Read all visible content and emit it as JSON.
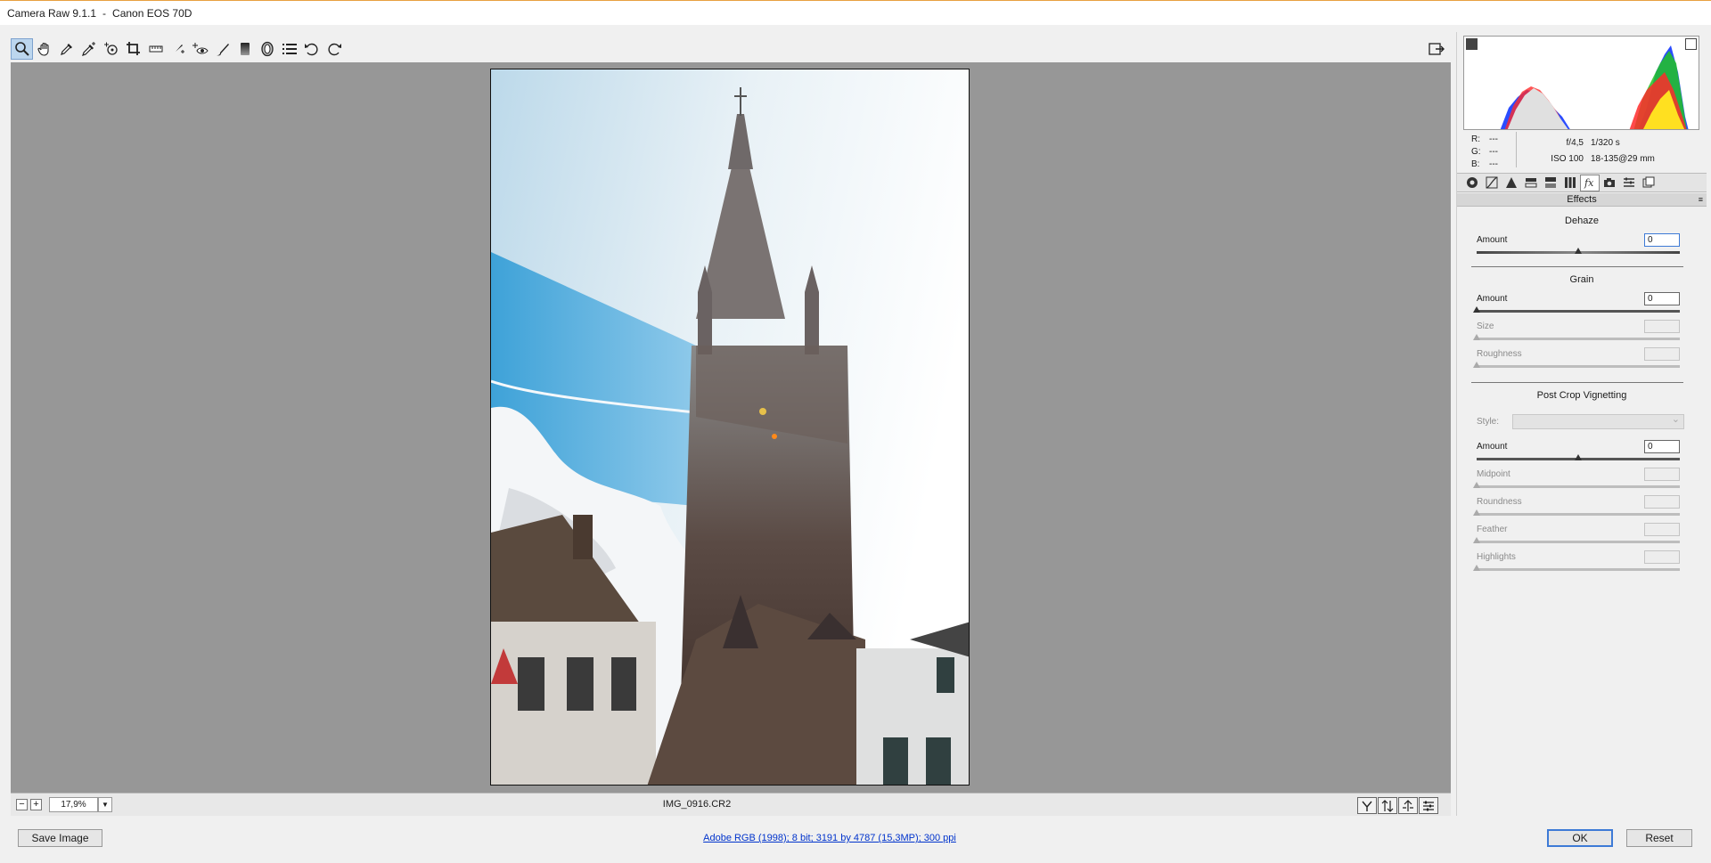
{
  "window": {
    "app": "Camera Raw 9.1.1",
    "separator": "-",
    "camera": "Canon EOS 70D"
  },
  "toolbar": {
    "tools": [
      {
        "name": "zoom-tool",
        "icon": "magnifier-icon",
        "active": true
      },
      {
        "name": "hand-tool",
        "icon": "hand-icon"
      },
      {
        "name": "white-balance-tool",
        "icon": "eyedropper-icon"
      },
      {
        "name": "color-sampler-tool",
        "icon": "color-sampler-icon"
      },
      {
        "name": "targeted-adjustment-tool",
        "icon": "target-icon"
      },
      {
        "name": "crop-tool",
        "icon": "crop-icon"
      },
      {
        "name": "straighten-tool",
        "icon": "straighten-icon"
      },
      {
        "name": "spot-removal-tool",
        "icon": "brush-spot-icon"
      },
      {
        "name": "red-eye-tool",
        "icon": "eye-icon"
      },
      {
        "name": "adjustment-brush-tool",
        "icon": "brush-icon"
      },
      {
        "name": "graduated-filter-tool",
        "icon": "graduated-filter-icon"
      },
      {
        "name": "radial-filter-tool",
        "icon": "radial-filter-icon"
      },
      {
        "name": "preferences-tool",
        "icon": "list-icon"
      },
      {
        "name": "rotate-ccw-tool",
        "icon": "rotate-left-icon"
      },
      {
        "name": "rotate-cw-tool",
        "icon": "rotate-right-icon"
      }
    ]
  },
  "bottombar": {
    "zoom_out": "−",
    "zoom_in": "+",
    "zoom_value": "17,9%",
    "filename": "IMG_0916.CR2"
  },
  "footer": {
    "save_label": "Save Image",
    "workflow_link": "Adobe RGB (1998); 8 bit; 3191 by 4787 (15,3MP); 300 ppi",
    "ok_label": "OK",
    "reset_label": "Reset"
  },
  "readout": {
    "r_label": "R:",
    "r_value": "---",
    "g_label": "G:",
    "g_value": "---",
    "b_label": "B:",
    "b_value": "---",
    "aperture": "f/4,5",
    "shutter": "1/320 s",
    "iso": "ISO 100",
    "lens": "18-135@29 mm"
  },
  "panel": {
    "title": "Effects",
    "dehaze": {
      "heading": "Dehaze",
      "amount_label": "Amount",
      "amount_value": "0",
      "amount_pos": 0.5
    },
    "grain": {
      "heading": "Grain",
      "amount_label": "Amount",
      "amount_value": "0",
      "size_label": "Size",
      "roughness_label": "Roughness"
    },
    "vignette": {
      "heading": "Post Crop Vignetting",
      "style_label": "Style:",
      "amount_label": "Amount",
      "amount_value": "0",
      "amount_pos": 0.5,
      "midpoint_label": "Midpoint",
      "roundness_label": "Roundness",
      "feather_label": "Feather",
      "highlights_label": "Highlights"
    }
  },
  "colors": {
    "accent": "#3d7ad6",
    "canvas_bg": "#979797",
    "link": "#0033cc"
  }
}
